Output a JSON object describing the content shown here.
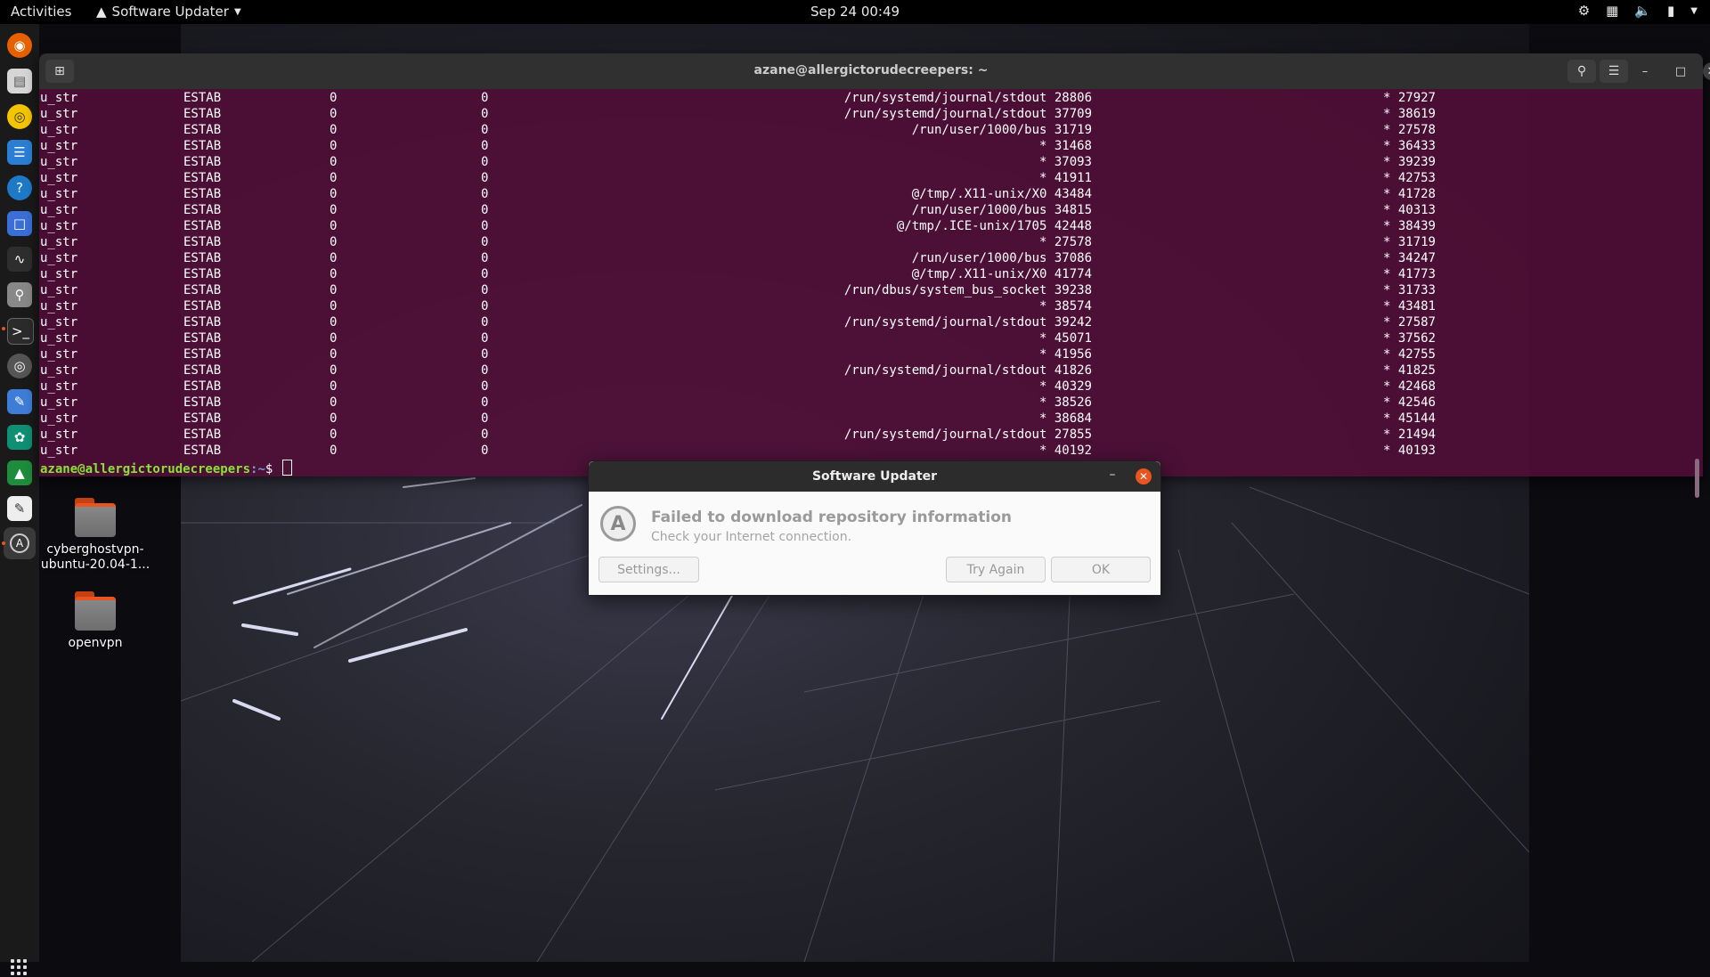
{
  "topbar": {
    "activities": "Activities",
    "app_menu": "Software Updater",
    "clock": "Sep 24  00:49"
  },
  "desktop": {
    "icons": [
      {
        "label": "cyberghostvpn-\nubuntu-20.04-1..."
      },
      {
        "label": "openvpn"
      }
    ]
  },
  "terminal": {
    "title": "azane@allergictorudecreepers: ~",
    "rows": [
      [
        "u_str",
        "ESTAB",
        "0",
        "0",
        "/run/systemd/journal/stdout 28806",
        "* 27927"
      ],
      [
        "u_str",
        "ESTAB",
        "0",
        "0",
        "/run/systemd/journal/stdout 37709",
        "* 38619"
      ],
      [
        "u_str",
        "ESTAB",
        "0",
        "0",
        "/run/user/1000/bus 31719",
        "* 27578"
      ],
      [
        "u_str",
        "ESTAB",
        "0",
        "0",
        "* 31468",
        "* 36433"
      ],
      [
        "u_str",
        "ESTAB",
        "0",
        "0",
        "* 37093",
        "* 39239"
      ],
      [
        "u_str",
        "ESTAB",
        "0",
        "0",
        "* 41911",
        "* 42753"
      ],
      [
        "u_str",
        "ESTAB",
        "0",
        "0",
        "@/tmp/.X11-unix/X0 43484",
        "* 41728"
      ],
      [
        "u_str",
        "ESTAB",
        "0",
        "0",
        "/run/user/1000/bus 34815",
        "* 40313"
      ],
      [
        "u_str",
        "ESTAB",
        "0",
        "0",
        "@/tmp/.ICE-unix/1705 42448",
        "* 38439"
      ],
      [
        "u_str",
        "ESTAB",
        "0",
        "0",
        "* 27578",
        "* 31719"
      ],
      [
        "u_str",
        "ESTAB",
        "0",
        "0",
        "/run/user/1000/bus 37086",
        "* 34247"
      ],
      [
        "u_str",
        "ESTAB",
        "0",
        "0",
        "@/tmp/.X11-unix/X0 41774",
        "* 41773"
      ],
      [
        "u_str",
        "ESTAB",
        "0",
        "0",
        "/run/dbus/system_bus_socket 39238",
        "* 31733"
      ],
      [
        "u_str",
        "ESTAB",
        "0",
        "0",
        "* 38574",
        "* 43481"
      ],
      [
        "u_str",
        "ESTAB",
        "0",
        "0",
        "/run/systemd/journal/stdout 39242",
        "* 27587"
      ],
      [
        "u_str",
        "ESTAB",
        "0",
        "0",
        "* 45071",
        "* 37562"
      ],
      [
        "u_str",
        "ESTAB",
        "0",
        "0",
        "* 41956",
        "* 42755"
      ],
      [
        "u_str",
        "ESTAB",
        "0",
        "0",
        "/run/systemd/journal/stdout 41826",
        "* 41825"
      ],
      [
        "u_str",
        "ESTAB",
        "0",
        "0",
        "* 40329",
        "* 42468"
      ],
      [
        "u_str",
        "ESTAB",
        "0",
        "0",
        "* 38526",
        "* 42546"
      ],
      [
        "u_str",
        "ESTAB",
        "0",
        "0",
        "* 38684",
        "* 45144"
      ],
      [
        "u_str",
        "ESTAB",
        "0",
        "0",
        "/run/systemd/journal/stdout 27855",
        "* 21494"
      ],
      [
        "u_str",
        "ESTAB",
        "0",
        "0",
        "* 40192",
        "* 40193"
      ]
    ],
    "prompt_user": "azane@allergictorudecreepers",
    "prompt_path": ":~",
    "prompt_symbol": "$ "
  },
  "dialog": {
    "title": "Software Updater",
    "heading": "Failed to download repository information",
    "subtext": "Check your Internet connection.",
    "settings_button": "Settings...",
    "try_again_button": "Try Again",
    "ok_button": "OK"
  },
  "colors": {
    "terminal_bg": "#520e38",
    "accent": "#e95420",
    "prompt_user": "#8ae234",
    "prompt_path": "#729fcf"
  }
}
